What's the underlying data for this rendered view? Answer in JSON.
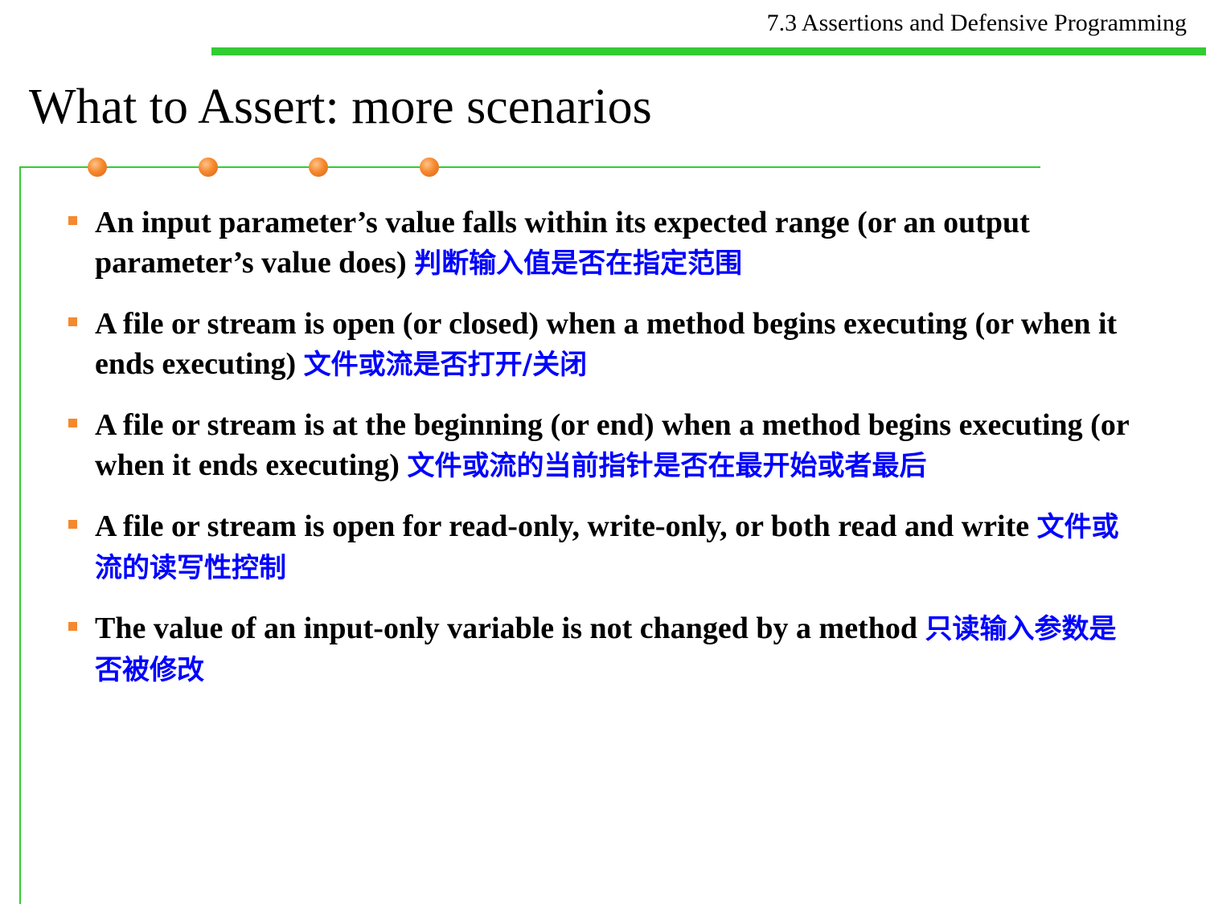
{
  "header": {
    "section": "7.3 Assertions and Defensive Programming"
  },
  "slide": {
    "title": "What to Assert: more scenarios"
  },
  "bullets": [
    {
      "en": "An input parameter’s value falls within its expected range (or an output  parameter’s value does) ",
      "zh": "判断输入值是否在指定范围"
    },
    {
      "en": "A file or stream is open (or closed) when a method begins executing (or when it ends executing) ",
      "zh": "文件或流是否打开/关闭"
    },
    {
      "en": "A file or stream is at the beginning (or end) when a method begins executing (or when it ends executing) ",
      "zh": "文件或流的当前指针是否在最开始或者最后"
    },
    {
      "en": "A file or stream is open for read-only, write-only, or both read and write ",
      "zh": "文件或流的读写性控制"
    },
    {
      "en": "The value of an input-only variable is not changed by a method ",
      "zh": "只读输入参数是否被修改"
    }
  ],
  "colors": {
    "accent_green": "#33cc33",
    "bullet_orange": "#f5892e",
    "chinese_text_blue": "#0000ff"
  }
}
